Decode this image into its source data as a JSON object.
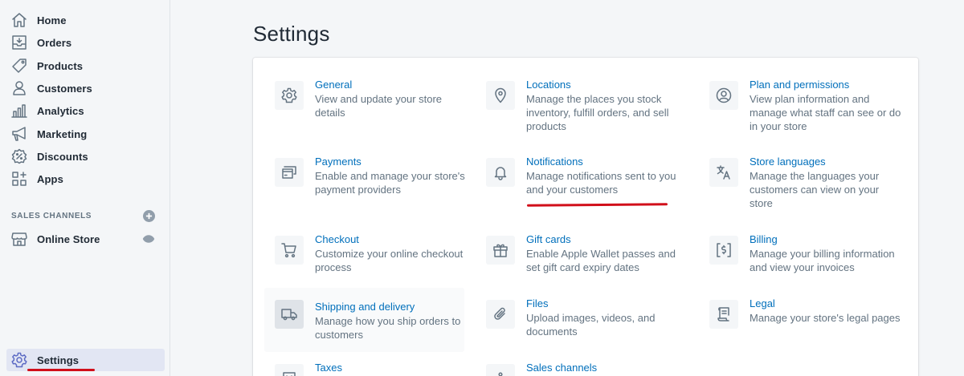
{
  "sidebar": {
    "items": [
      {
        "label": "Home",
        "icon": "home-icon"
      },
      {
        "label": "Orders",
        "icon": "orders-icon"
      },
      {
        "label": "Products",
        "icon": "tag-icon"
      },
      {
        "label": "Customers",
        "icon": "person-icon"
      },
      {
        "label": "Analytics",
        "icon": "bar-chart-icon"
      },
      {
        "label": "Marketing",
        "icon": "megaphone-icon"
      },
      {
        "label": "Discounts",
        "icon": "discount-icon"
      },
      {
        "label": "Apps",
        "icon": "apps-icon"
      }
    ],
    "sales_channels_label": "SALES CHANNELS",
    "online_store_label": "Online Store",
    "settings_label": "Settings"
  },
  "main": {
    "title": "Settings",
    "settings": [
      {
        "title": "General",
        "desc": "View and update your store details",
        "icon": "gear-icon"
      },
      {
        "title": "Locations",
        "desc": "Manage the places you stock inventory, fulfill orders, and sell products",
        "icon": "location-pin-icon"
      },
      {
        "title": "Plan and permissions",
        "desc": "View plan information and manage what staff can see or do in your store",
        "icon": "account-icon"
      },
      {
        "title": "Payments",
        "desc": "Enable and manage your store's payment providers",
        "icon": "credit-card-icon"
      },
      {
        "title": "Notifications",
        "desc": "Manage notifications sent to you and your customers",
        "icon": "bell-icon"
      },
      {
        "title": "Store languages",
        "desc": "Manage the languages your customers can view on your store",
        "icon": "translate-icon"
      },
      {
        "title": "Checkout",
        "desc": "Customize your online checkout process",
        "icon": "cart-icon"
      },
      {
        "title": "Gift cards",
        "desc": "Enable Apple Wallet passes and set gift card expiry dates",
        "icon": "gift-icon"
      },
      {
        "title": "Billing",
        "desc": "Manage your billing information and view your invoices",
        "icon": "invoice-icon"
      },
      {
        "title": "Shipping and delivery",
        "desc": "Manage how you ship orders to customers",
        "icon": "truck-icon"
      },
      {
        "title": "Files",
        "desc": "Upload images, videos, and documents",
        "icon": "paperclip-icon"
      },
      {
        "title": "Legal",
        "desc": "Manage your store's legal pages",
        "icon": "legal-document-icon"
      },
      {
        "title": "Taxes",
        "desc": "",
        "icon": "taxes-icon"
      },
      {
        "title": "Sales channels",
        "desc": "",
        "icon": "sales-channels-icon"
      }
    ]
  },
  "colors": {
    "link": "#006fbb",
    "muted_text": "#637381",
    "annotation_red": "#d10f1a",
    "active_nav": "#e2e6f3"
  }
}
